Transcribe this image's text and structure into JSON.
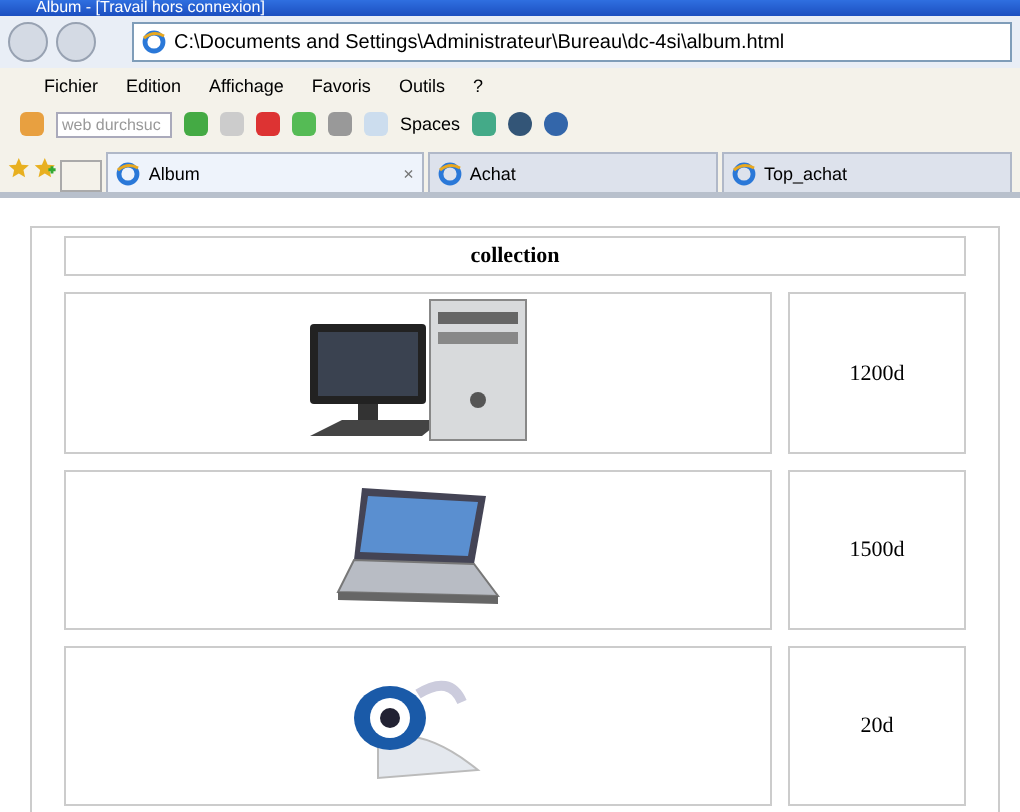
{
  "window": {
    "title": "Album - [Travail hors connexion]"
  },
  "address_bar": {
    "url": "C:\\Documents and Settings\\Administrateur\\Bureau\\dc-4si\\album.html"
  },
  "menu": [
    "Fichier",
    "Edition",
    "Affichage",
    "Favoris",
    "Outils",
    "?"
  ],
  "toolbar": {
    "search": {
      "placeholder": "web durchsuc"
    },
    "spaces_label": "Spaces"
  },
  "tabs": [
    {
      "label": "Album",
      "selected": true,
      "close": "×"
    },
    {
      "label": "Achat",
      "selected": false
    },
    {
      "label": "Top_achat",
      "selected": false
    }
  ],
  "page": {
    "header": "collection",
    "rows": [
      {
        "kind": "desktop",
        "price": "1200d"
      },
      {
        "kind": "laptop",
        "price": "1500d"
      },
      {
        "kind": "webcam",
        "price": "20d"
      }
    ]
  }
}
